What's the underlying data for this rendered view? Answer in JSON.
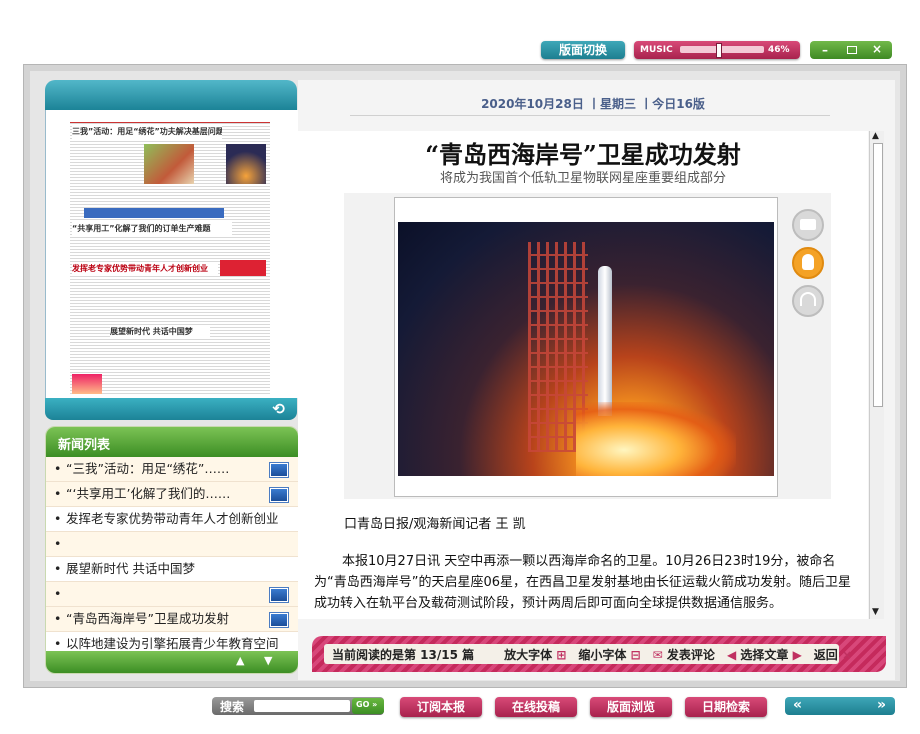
{
  "top_controls": {
    "layout_switch": "版面切换",
    "music_label": "MUSIC",
    "music_volume": "46%",
    "music_volume_fraction": 0.46
  },
  "header": {
    "date_line": "2020年10月28日 丨星期三 丨今日16版"
  },
  "news_list": {
    "title": "新闻列表",
    "items": [
      {
        "text": "“三我”活动：用足“绣花”……",
        "video": true
      },
      {
        "text": "“‘共享用工’化解了我们的……",
        "video": true
      },
      {
        "text": "发挥老专家优势带动青年人才创新创业",
        "video": false
      },
      {
        "text": "",
        "video": false
      },
      {
        "text": "展望新时代 共话中国梦",
        "video": false
      },
      {
        "text": "",
        "video": true
      },
      {
        "text": "“青岛西海岸号”卫星成功发射",
        "video": true
      },
      {
        "text": "以阵地建设为引擎拓展青少年教育空间",
        "video": false
      }
    ]
  },
  "article": {
    "title": "“青岛西海岸号”卫星成功发射",
    "subtitle": "将成为我国首个低轨卫星物联网星座重要组成部分",
    "byline": "口青岛日报/观海新闻记者 王 凯",
    "paragraph": "本报10月27日讯 天空中再添一颗以西海岸命名的卫星。10月26日23时19分，被命名为“青岛西海岸号”的天启星座06星，在西昌卫星发射基地由长征运载火箭成功发射。随后卫星成功转入在轨平台及载荷测试阶段，预计两周后即可面向全球提供数据通信服务。"
  },
  "toolbar": {
    "reading_status": "当前阅读的是第 13/15 篇",
    "enlarge": "放大字体",
    "shrink": "缩小字体",
    "comment": "发表评论",
    "choose": "选择文章",
    "back": "返回"
  },
  "newspaper_thumb": {
    "headline1": "三我”活动：用足“绣花”功夫解决基层问题",
    "headline2": "“共享用工”化解了我们的订单生产难题",
    "headline3": "发挥老专家优势带动青年人才创新创业",
    "headline4": "展望新时代 共话中国梦"
  },
  "bottom": {
    "search_label": "搜索",
    "search_go": "GO »",
    "subscribe": "订阅本报",
    "submit": "在线投稿",
    "browse": "版面浏览",
    "date_search": "日期检索",
    "prev": "«",
    "next": "»"
  },
  "colors": {
    "teal": "#1d8ca0",
    "pink": "#c03060",
    "green": "#4e9a32"
  }
}
